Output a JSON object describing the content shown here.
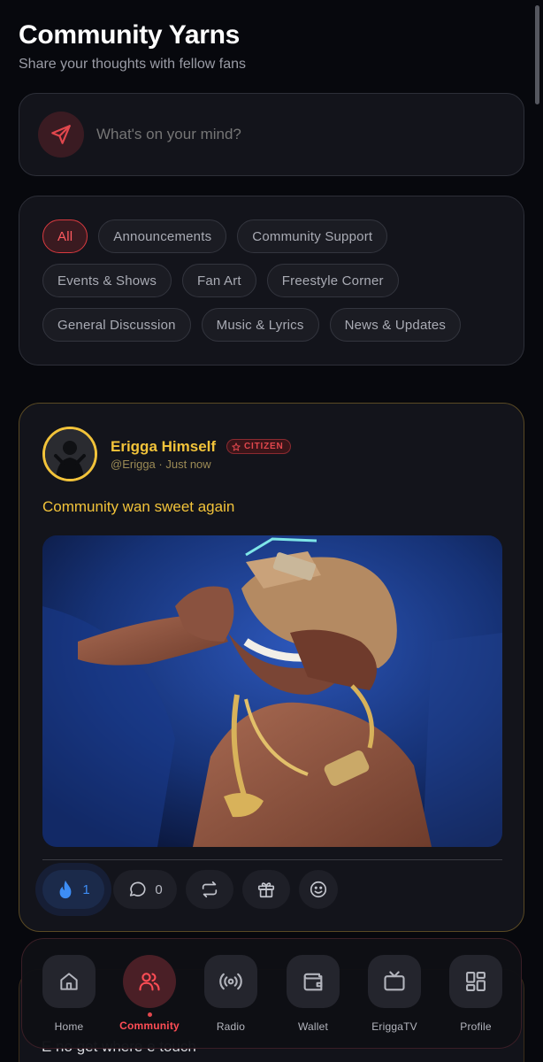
{
  "colors": {
    "accent_red": "#e1474d",
    "gold": "#f2c33a",
    "like_blue": "#3d8df5",
    "background": "#07080d",
    "card": "#13141b"
  },
  "header": {
    "title": "Community Yarns",
    "subtitle": "Share your thoughts with fellow fans"
  },
  "composer": {
    "icon": "send-icon",
    "placeholder": "What's on your mind?"
  },
  "filters": {
    "rows": [
      [
        "All",
        "Announcements",
        "Community Support"
      ],
      [
        "Events & Shows",
        "Fan Art",
        "Freestyle Corner"
      ],
      [
        "General Discussion",
        "Music & Lyrics",
        "News & Updates"
      ]
    ],
    "selected": "All"
  },
  "post": {
    "author": "Erigga Himself",
    "badge": "CITIZEN",
    "handle": "@Erigga",
    "time": "Just now",
    "text": "Community wan sweet again",
    "reactions": {
      "likes": "1",
      "comments": "0"
    }
  },
  "next_post_preview": {
    "text": "E no get where e touch"
  },
  "bottom_nav": {
    "items": [
      {
        "label": "Home",
        "icon": "home-icon"
      },
      {
        "label": "Community",
        "icon": "users-icon",
        "active": true
      },
      {
        "label": "Radio",
        "icon": "radio-icon"
      },
      {
        "label": "Wallet",
        "icon": "wallet-icon"
      },
      {
        "label": "EriggaTV",
        "icon": "tv-icon"
      },
      {
        "label": "Profile",
        "icon": "grid-icon"
      }
    ]
  }
}
